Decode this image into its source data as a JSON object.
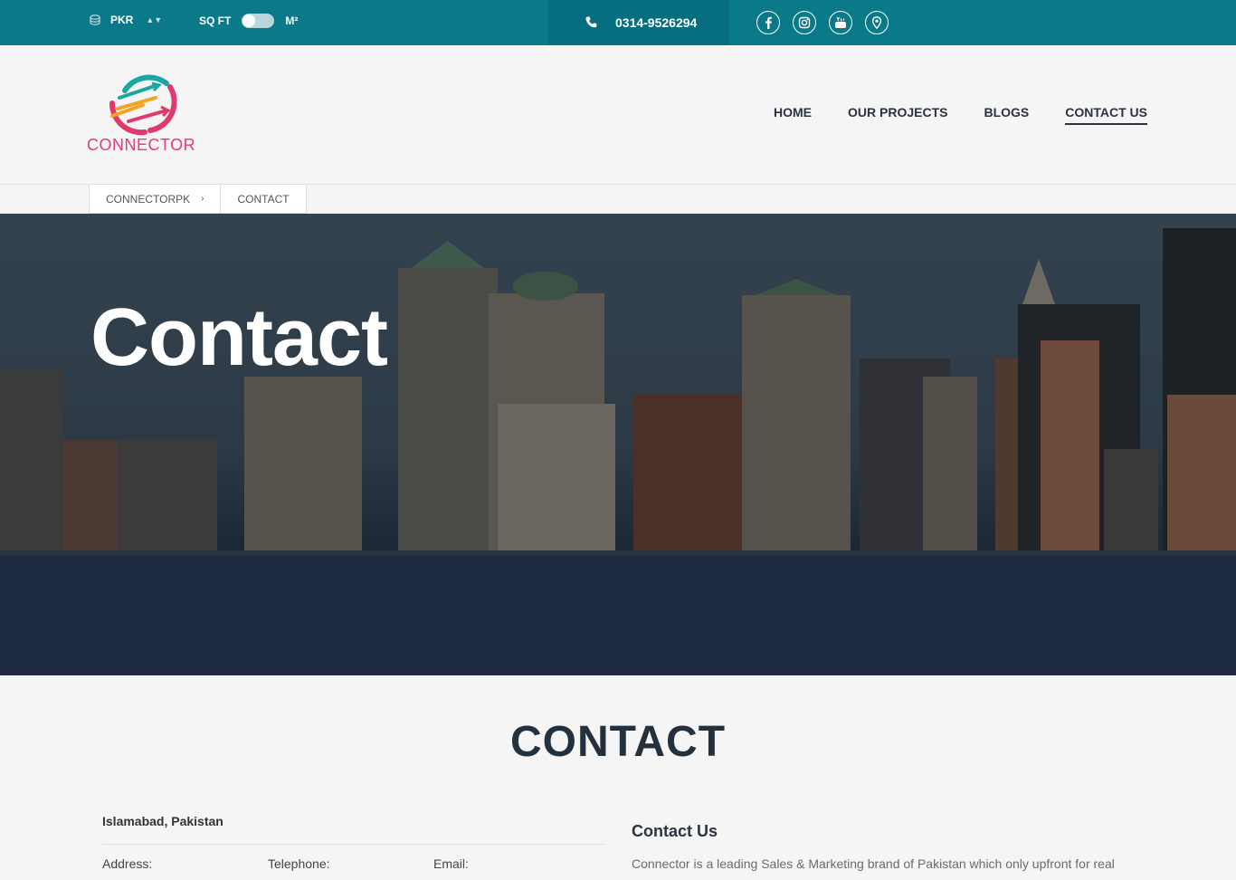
{
  "topbar": {
    "currency": "PKR",
    "unit_left": "SQ FT",
    "unit_right": "M²",
    "phone": "0314-9526294",
    "social": [
      "facebook-icon",
      "instagram-icon",
      "youtube-icon",
      "map-pin-icon"
    ],
    "bg_color": "#0a7a8a"
  },
  "logo": {
    "text": "CONNECTOR"
  },
  "nav": {
    "items": [
      {
        "label": "HOME"
      },
      {
        "label": "OUR PROJECTS"
      },
      {
        "label": "BLOGS"
      },
      {
        "label": "CONTACT US"
      }
    ],
    "active": "CONTACT US"
  },
  "breadcrumb": {
    "items": [
      "CONNECTORPK",
      "CONTACT"
    ],
    "separator": "›"
  },
  "hero": {
    "title": "Contact"
  },
  "section": {
    "title": "CONTACT",
    "city": "Islamabad, Pakistan",
    "labels": {
      "address": "Address:",
      "telephone": "Telephone:",
      "email": "Email:"
    },
    "contact_us_title": "Contact Us",
    "contact_us_text": "Connector is a leading Sales & Marketing brand of Pakistan which only upfront for real"
  }
}
